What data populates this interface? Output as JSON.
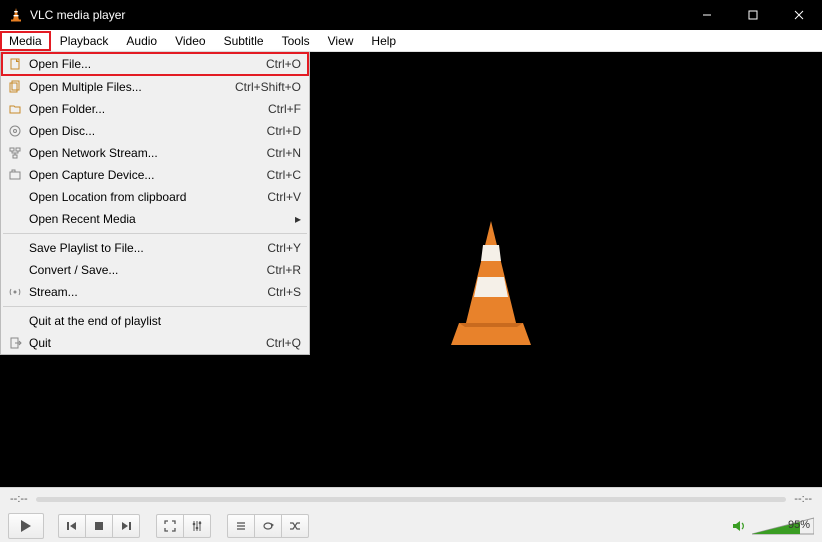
{
  "window": {
    "title": "VLC media player"
  },
  "menubar": [
    "Media",
    "Playback",
    "Audio",
    "Video",
    "Subtitle",
    "Tools",
    "View",
    "Help"
  ],
  "active_menu_index": 0,
  "dropdown": [
    {
      "type": "item",
      "icon": "file",
      "label": "Open File...",
      "shortcut": "Ctrl+O",
      "highlight": true
    },
    {
      "type": "item",
      "icon": "files",
      "label": "Open Multiple Files...",
      "shortcut": "Ctrl+Shift+O"
    },
    {
      "type": "item",
      "icon": "folder",
      "label": "Open Folder...",
      "shortcut": "Ctrl+F"
    },
    {
      "type": "item",
      "icon": "disc",
      "label": "Open Disc...",
      "shortcut": "Ctrl+D"
    },
    {
      "type": "item",
      "icon": "network",
      "label": "Open Network Stream...",
      "shortcut": "Ctrl+N"
    },
    {
      "type": "item",
      "icon": "capture",
      "label": "Open Capture Device...",
      "shortcut": "Ctrl+C"
    },
    {
      "type": "item",
      "icon": "",
      "label": "Open Location from clipboard",
      "shortcut": "Ctrl+V"
    },
    {
      "type": "item",
      "icon": "",
      "label": "Open Recent Media",
      "shortcut": "",
      "submenu": true
    },
    {
      "type": "sep"
    },
    {
      "type": "item",
      "icon": "",
      "label": "Save Playlist to File...",
      "shortcut": "Ctrl+Y"
    },
    {
      "type": "item",
      "icon": "",
      "label": "Convert / Save...",
      "shortcut": "Ctrl+R"
    },
    {
      "type": "item",
      "icon": "stream",
      "label": "Stream...",
      "shortcut": "Ctrl+S"
    },
    {
      "type": "sep"
    },
    {
      "type": "item",
      "icon": "",
      "label": "Quit at the end of playlist",
      "shortcut": ""
    },
    {
      "type": "item",
      "icon": "quit",
      "label": "Quit",
      "shortcut": "Ctrl+Q"
    }
  ],
  "timeline": {
    "elapsed": "--:--",
    "total": "--:--"
  },
  "volume": {
    "percent": "95%"
  }
}
